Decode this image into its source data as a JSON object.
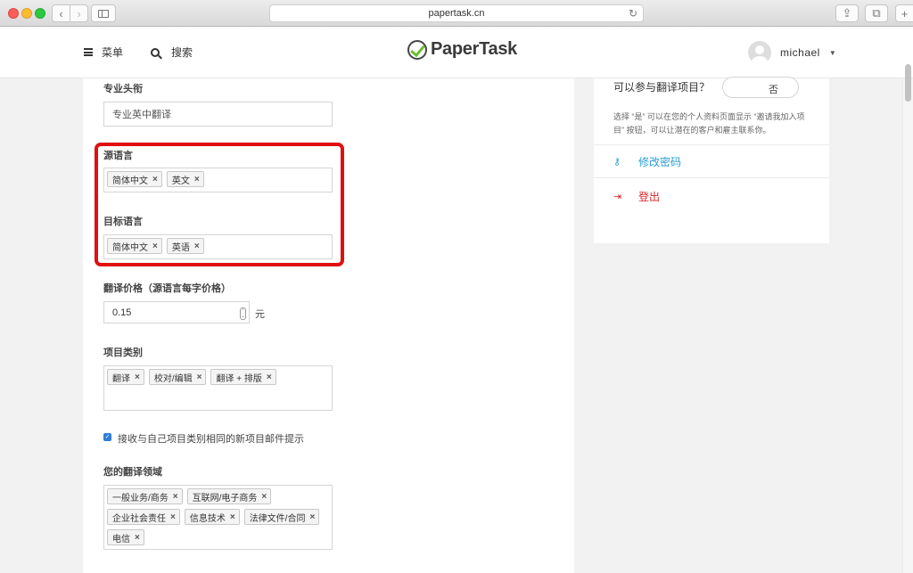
{
  "browser": {
    "url": "papertask.cn",
    "back_icon": "‹",
    "forward_icon": "›",
    "reload_icon": "↻",
    "share_icon": "⇪",
    "tabs_icon": "⧉",
    "plus_icon": "+"
  },
  "header": {
    "menu_label": "菜单",
    "search_label": "搜索",
    "logo_text": "PaperTask",
    "username": "michael",
    "caret": "▼"
  },
  "form": {
    "title_label": "专业头衔",
    "title_value": "专业英中翻译",
    "source_lang_label": "源语言",
    "source_langs": [
      "简体中文",
      "英文"
    ],
    "target_lang_label": "目标语言",
    "target_langs": [
      "简体中文",
      "英语"
    ],
    "price_label": "翻译价格（源语言每字价格）",
    "price_value": "0.15",
    "price_unit": "元",
    "category_label": "项目类别",
    "categories": [
      "翻译",
      "校对/编辑",
      "翻译 + 排版"
    ],
    "email_notify_label": "接收与自己项目类别相同的新项目邮件提示",
    "email_notify_checked": true,
    "domain_label": "您的翻译领域",
    "domains_row1": [
      "一般业务/商务",
      "互联网/电子商务"
    ],
    "domains_row2": [
      "企业社会责任",
      "信息技术",
      "法律文件/合同"
    ],
    "domains_row3": [
      "电信"
    ],
    "tag_remove": "×",
    "check_mark": "✓",
    "highlight_color": "#e01010"
  },
  "sidebar": {
    "invite_question": "可以参与翻译项目？",
    "toggle_value": "否",
    "invite_desc_line1": "选择 “是” 可以在您的个人资料页面显示 “邀请我加入项",
    "invite_desc_line2": "目” 按钮，可以让潜在的客户和雇主联系你。",
    "change_password": "修改密码",
    "logout": "登出",
    "link_color": "#2a9fd6",
    "logout_color": "#d9262a"
  }
}
